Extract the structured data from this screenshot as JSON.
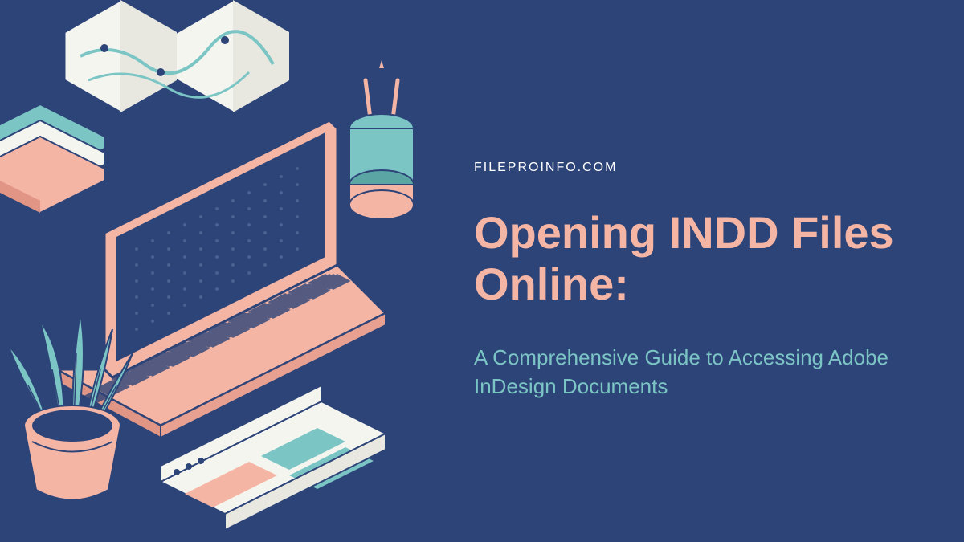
{
  "eyebrow": "FILEPROINFO.COM",
  "title": "Opening INDD Files Online:",
  "subtitle": "A Comprehensive Guide to Accessing Adobe InDesign Documents",
  "colors": {
    "background": "#2d4478",
    "accent_pink": "#f5b5a5",
    "accent_teal": "#7cc5c5",
    "white": "#ffffff"
  }
}
